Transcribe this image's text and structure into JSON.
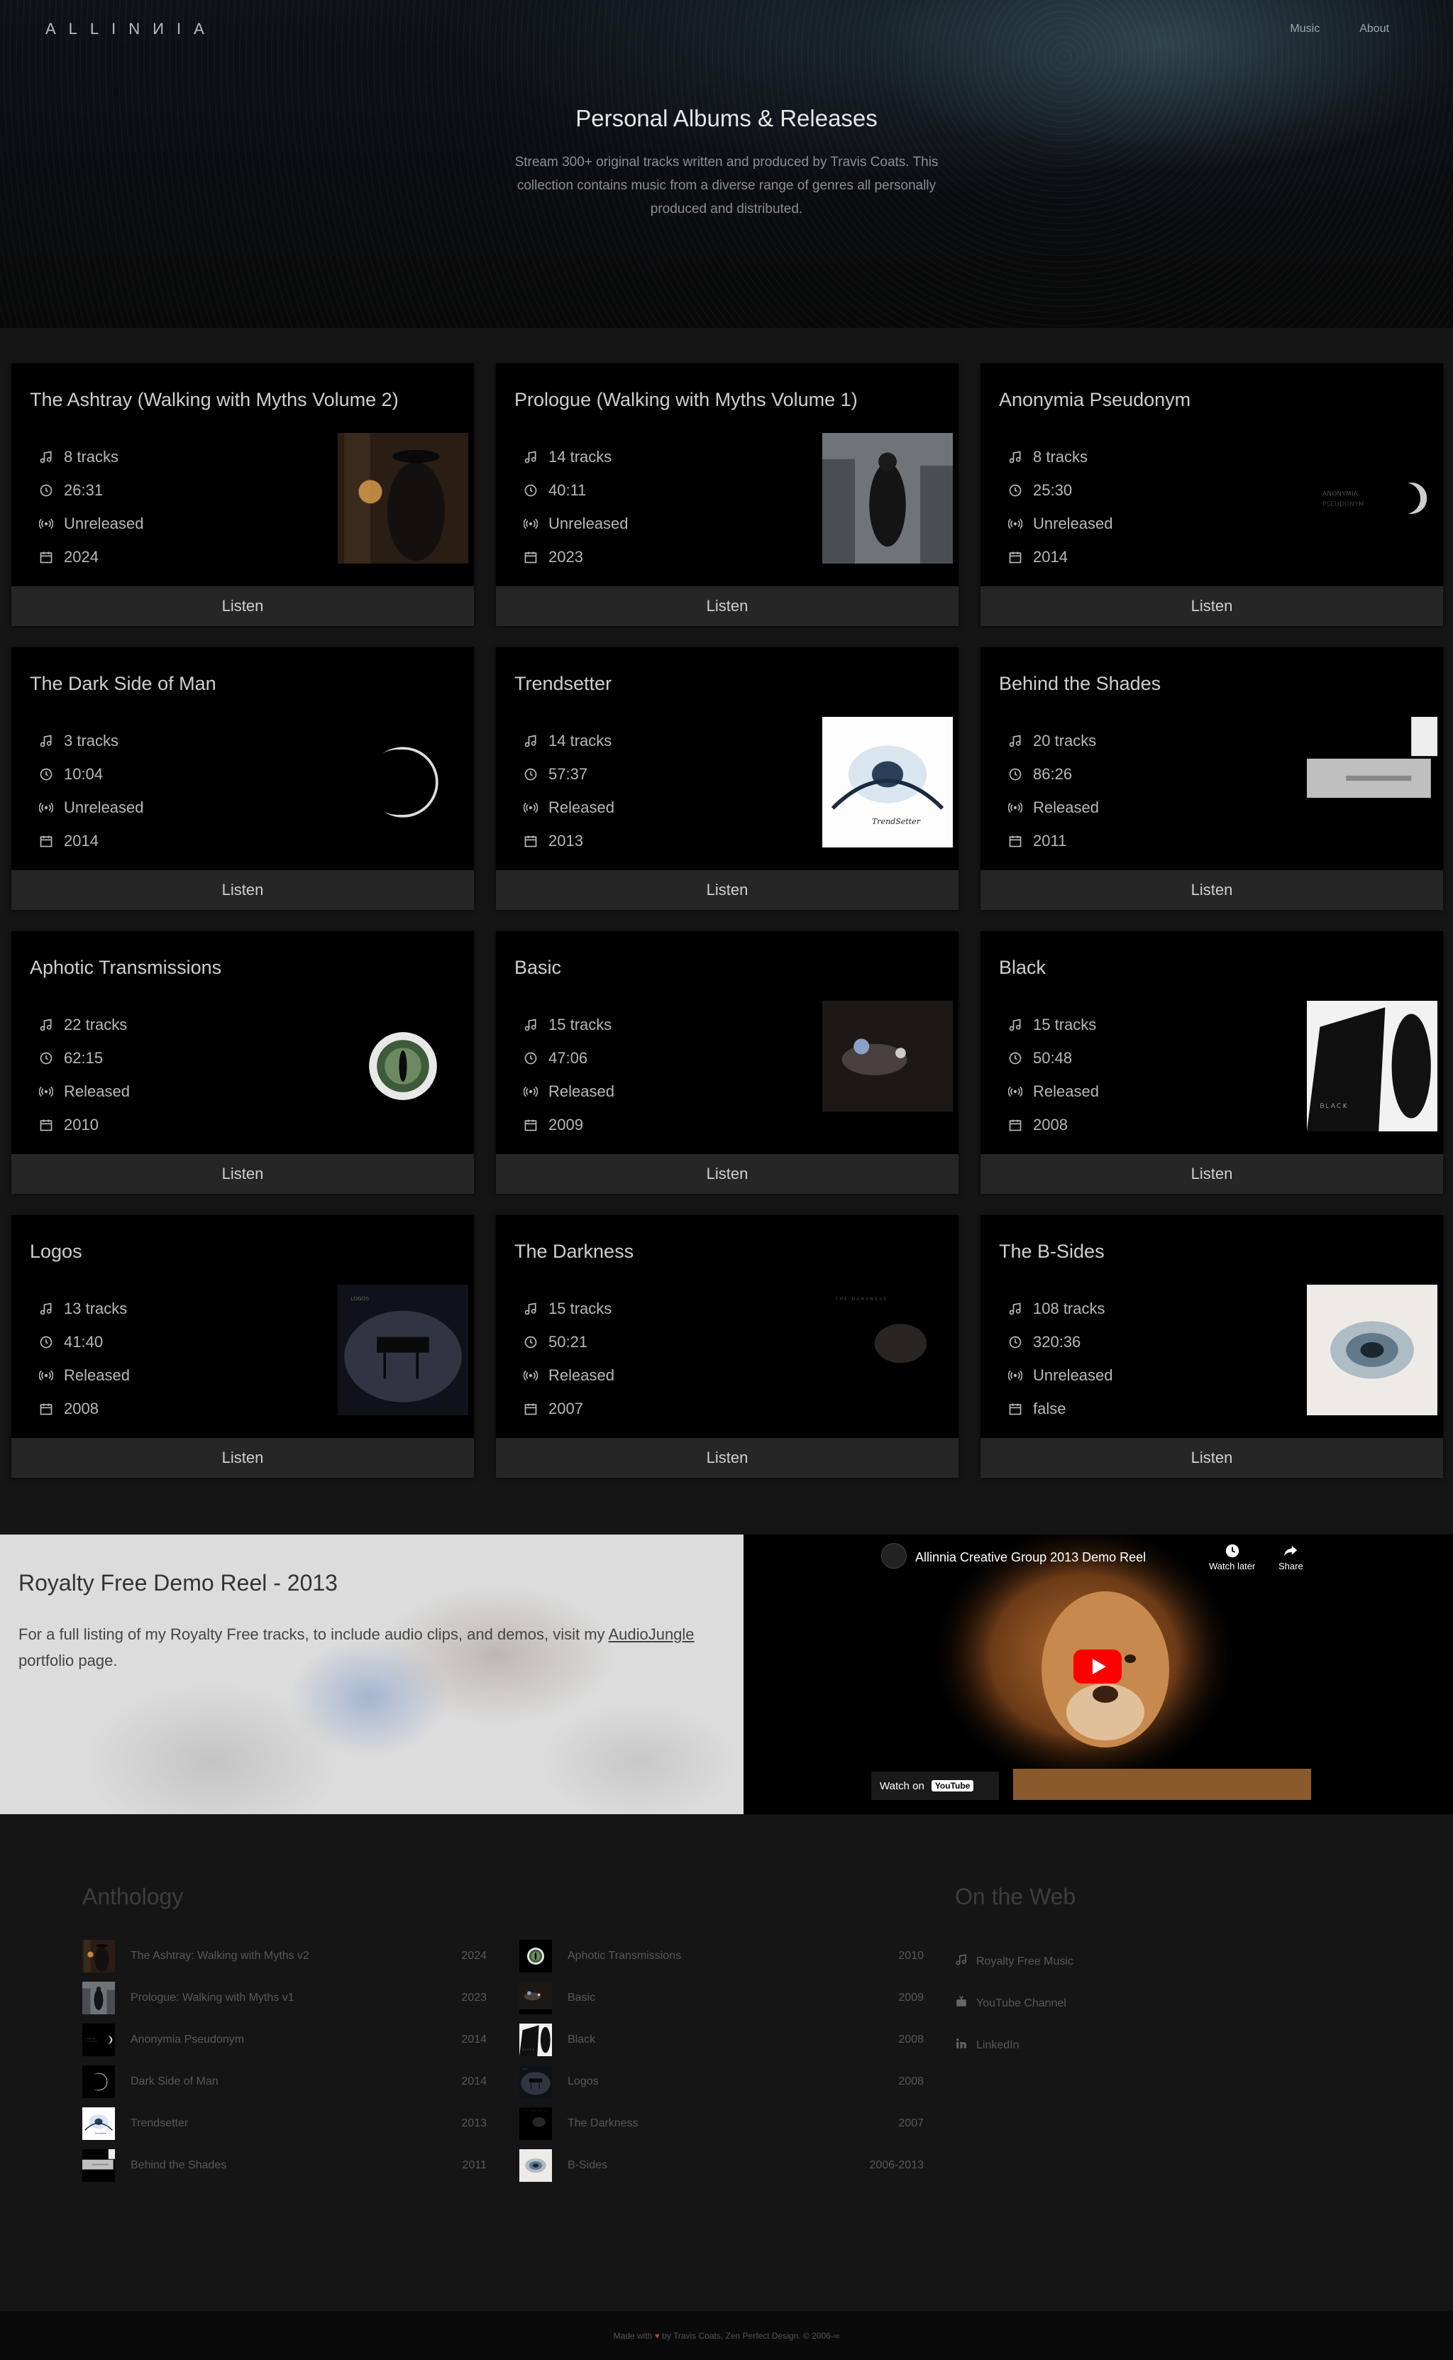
{
  "header": {
    "logo": "ALLINИIA",
    "nav": [
      "Music",
      "About"
    ],
    "title": "Personal Albums & Releases",
    "description": "Stream 300+ original tracks written and produced by Travis Coats. This collection contains music from a diverse range of genres all personally produced and distributed."
  },
  "albums": [
    {
      "title": "The Ashtray (Walking with Myths Volume 2)",
      "tracks": "8 tracks",
      "duration": "26:31",
      "status": "Unreleased",
      "year": "2024",
      "listen": "Listen",
      "cover": "ashtray"
    },
    {
      "title": "Prologue (Walking with Myths Volume 1)",
      "tracks": "14 tracks",
      "duration": "40:11",
      "status": "Unreleased",
      "year": "2023",
      "listen": "Listen",
      "cover": "prologue"
    },
    {
      "title": "Anonymia Pseudonym",
      "tracks": "8 tracks",
      "duration": "25:30",
      "status": "Unreleased",
      "year": "2014",
      "listen": "Listen",
      "cover": "anonymia"
    },
    {
      "title": "The Dark Side of Man",
      "tracks": "3 tracks",
      "duration": "10:04",
      "status": "Unreleased",
      "year": "2014",
      "listen": "Listen",
      "cover": "darkside"
    },
    {
      "title": "Trendsetter",
      "tracks": "14 tracks",
      "duration": "57:37",
      "status": "Released",
      "year": "2013",
      "listen": "Listen",
      "cover": "trendsetter"
    },
    {
      "title": "Behind the Shades",
      "tracks": "20 tracks",
      "duration": "86:26",
      "status": "Released",
      "year": "2011",
      "listen": "Listen",
      "cover": "shades"
    },
    {
      "title": "Aphotic Transmissions",
      "tracks": "22 tracks",
      "duration": "62:15",
      "status": "Released",
      "year": "2010",
      "listen": "Listen",
      "cover": "aphotic"
    },
    {
      "title": "Basic",
      "tracks": "15 tracks",
      "duration": "47:06",
      "status": "Released",
      "year": "2009",
      "listen": "Listen",
      "cover": "basic"
    },
    {
      "title": "Black",
      "tracks": "15 tracks",
      "duration": "50:48",
      "status": "Released",
      "year": "2008",
      "listen": "Listen",
      "cover": "black"
    },
    {
      "title": "Logos",
      "tracks": "13 tracks",
      "duration": "41:40",
      "status": "Released",
      "year": "2008",
      "listen": "Listen",
      "cover": "logos"
    },
    {
      "title": "The Darkness",
      "tracks": "15 tracks",
      "duration": "50:21",
      "status": "Released",
      "year": "2007",
      "listen": "Listen",
      "cover": "darkness"
    },
    {
      "title": "The B-Sides",
      "tracks": "108 tracks",
      "duration": "320:36",
      "status": "Unreleased",
      "year": "false",
      "listen": "Listen",
      "cover": "bsides"
    }
  ],
  "demo_reel": {
    "title": "Royalty Free Demo Reel - 2013",
    "text_before": "For a full listing of my Royalty Free tracks, to include audio clips, and demos, visit my ",
    "link": "AudioJungle",
    "text_after": " portfolio page."
  },
  "video": {
    "title": "Allinnia Creative Group 2013 Demo Reel",
    "watch_later": "Watch later",
    "share": "Share",
    "watch_on": "Watch on",
    "youtube": "YouTube"
  },
  "anthology": {
    "heading": "Anthology",
    "left": [
      {
        "name": "The Ashtray: Walking with Myths v2",
        "year": "2024",
        "cover": "ashtray"
      },
      {
        "name": "Prologue: Walking with Myths v1",
        "year": "2023",
        "cover": "prologue"
      },
      {
        "name": "Anonymia Pseudonym",
        "year": "2014",
        "cover": "anonymia"
      },
      {
        "name": "Dark Side of Man",
        "year": "2014",
        "cover": "darkside"
      },
      {
        "name": "Trendsetter",
        "year": "2013",
        "cover": "trendsetter"
      },
      {
        "name": "Behind the Shades",
        "year": "2011",
        "cover": "shades"
      }
    ],
    "right": [
      {
        "name": "Aphotic Transmissions",
        "year": "2010",
        "cover": "aphotic"
      },
      {
        "name": "Basic",
        "year": "2009",
        "cover": "basic"
      },
      {
        "name": "Black",
        "year": "2008",
        "cover": "black"
      },
      {
        "name": "Logos",
        "year": "2008",
        "cover": "logos"
      },
      {
        "name": "The Darkness",
        "year": "2007",
        "cover": "darkness"
      },
      {
        "name": "B-Sides",
        "year": "2006-2013",
        "cover": "bsides"
      }
    ]
  },
  "on_the_web": {
    "heading": "On the Web",
    "items": [
      {
        "label": "Royalty Free Music",
        "icon": "music-note-icon"
      },
      {
        "label": "YouTube Channel",
        "icon": "youtube-icon"
      },
      {
        "label": "LinkedIn",
        "icon": "linkedin-icon"
      }
    ]
  },
  "footer": {
    "made_with": "Made with",
    "by": "by Travis Coats, Zen Perfect Design. © 2006-∞"
  }
}
